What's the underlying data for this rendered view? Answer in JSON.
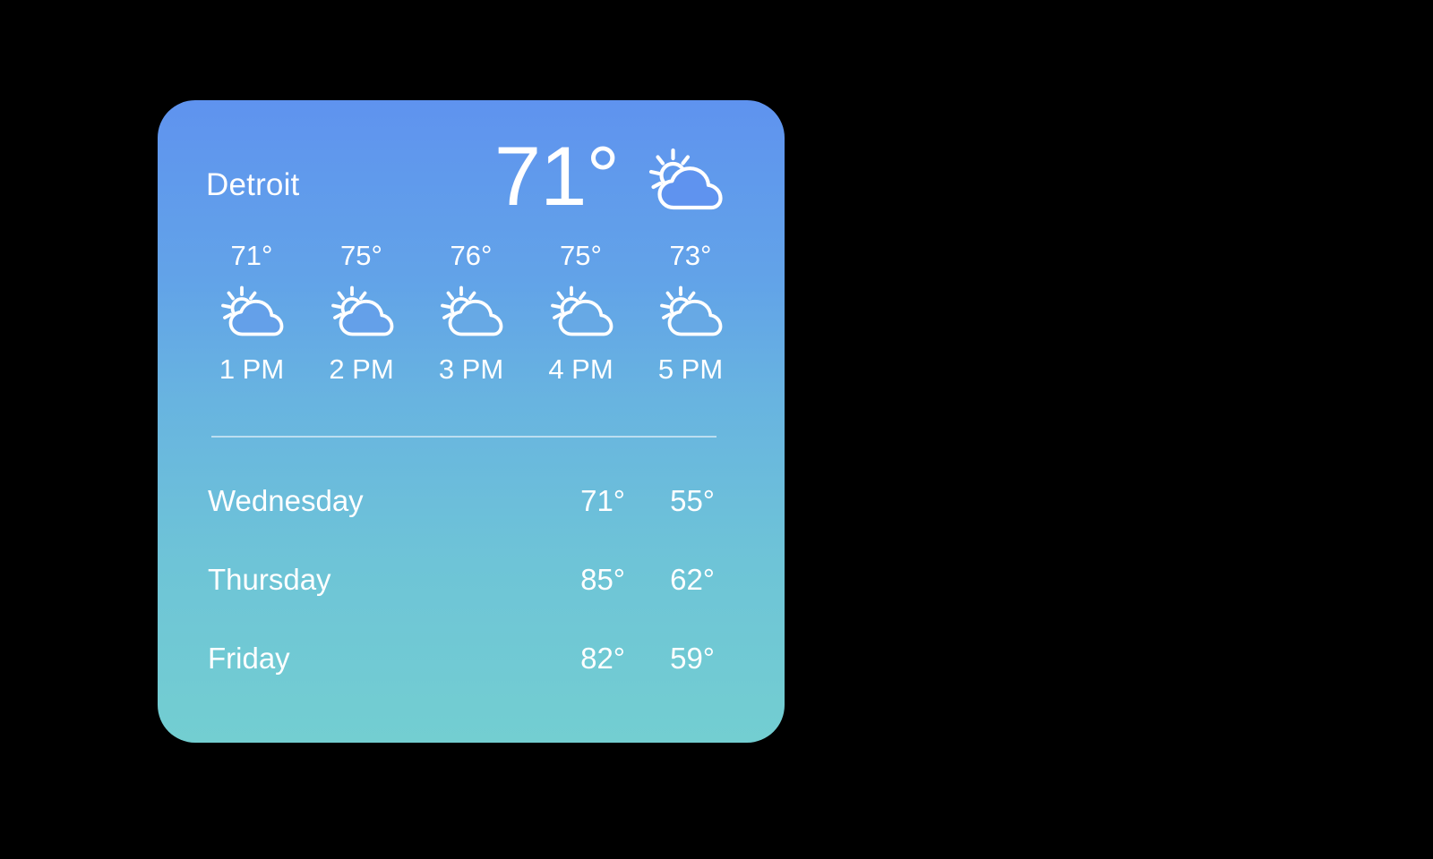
{
  "widget": {
    "type": "weather-widget",
    "colors": {
      "gradient_top": "#5f93ef",
      "gradient_mid": "#68b4e0",
      "gradient_bottom": "#73ced1",
      "text": "#ffffff",
      "page_background": "#000000",
      "divider": "rgba(255,255,255,0.55)"
    }
  },
  "current": {
    "city": "Detroit",
    "temperature": "71°",
    "condition_icon": "sun-behind-cloud-icon"
  },
  "hourly": {
    "items": [
      {
        "temp": "71°",
        "time": "1 PM",
        "icon": "sun-behind-cloud-icon"
      },
      {
        "temp": "75°",
        "time": "2 PM",
        "icon": "sun-behind-cloud-icon"
      },
      {
        "temp": "76°",
        "time": "3 PM",
        "icon": "sun-behind-cloud-icon"
      },
      {
        "temp": "75°",
        "time": "4 PM",
        "icon": "sun-behind-cloud-icon"
      },
      {
        "temp": "73°",
        "time": "5 PM",
        "icon": "sun-behind-cloud-icon"
      }
    ]
  },
  "daily": {
    "rows": [
      {
        "day": "Wednesday",
        "high": "71°",
        "low": "55°"
      },
      {
        "day": "Thursday",
        "high": "85°",
        "low": "62°"
      },
      {
        "day": "Friday",
        "high": "82°",
        "low": "59°"
      }
    ]
  }
}
